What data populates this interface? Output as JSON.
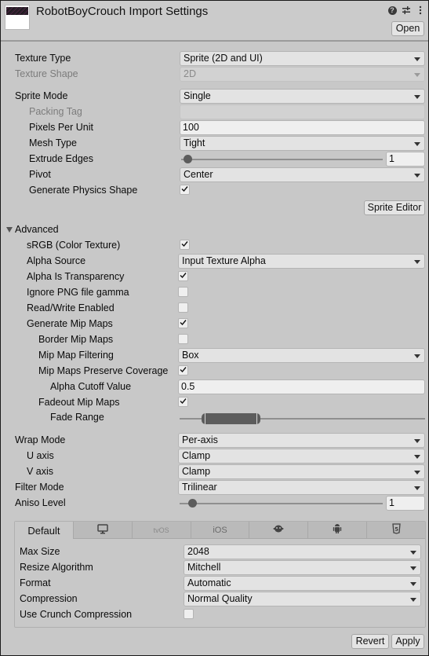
{
  "header": {
    "title": "RobotBoyCrouch Import Settings",
    "open_label": "Open",
    "icons": [
      "help-icon",
      "preset-sliders-icon",
      "more-menu-icon"
    ]
  },
  "texture": {
    "texture_type": {
      "label": "Texture Type",
      "value": "Sprite (2D and UI)"
    },
    "texture_shape": {
      "label": "Texture Shape",
      "value": "2D"
    },
    "sprite_mode": {
      "label": "Sprite Mode",
      "value": "Single"
    },
    "packing_tag": {
      "label": "Packing Tag",
      "value": ""
    },
    "pixels_per_unit": {
      "label": "Pixels Per Unit",
      "value": "100"
    },
    "mesh_type": {
      "label": "Mesh Type",
      "value": "Tight"
    },
    "extrude_edges": {
      "label": "Extrude Edges",
      "value": "1",
      "slider_fraction": 0.03
    },
    "pivot": {
      "label": "Pivot",
      "value": "Center"
    },
    "generate_physics_shape": {
      "label": "Generate Physics Shape",
      "checked": true
    },
    "sprite_editor_label": "Sprite Editor"
  },
  "advanced": {
    "label": "Advanced",
    "expanded": true,
    "srgb": {
      "label": "sRGB (Color Texture)",
      "checked": true
    },
    "alpha_source": {
      "label": "Alpha Source",
      "value": "Input Texture Alpha"
    },
    "alpha_is_transparency": {
      "label": "Alpha Is Transparency",
      "checked": true
    },
    "ignore_png_gamma": {
      "label": "Ignore PNG file gamma",
      "checked": false
    },
    "read_write": {
      "label": "Read/Write Enabled",
      "checked": false
    },
    "generate_mip_maps": {
      "label": "Generate Mip Maps",
      "checked": true
    },
    "border_mip_maps": {
      "label": "Border Mip Maps",
      "checked": false
    },
    "mip_map_filtering": {
      "label": "Mip Map Filtering",
      "value": "Box"
    },
    "mip_preserve_coverage": {
      "label": "Mip Maps Preserve Coverage",
      "checked": true
    },
    "alpha_cutoff": {
      "label": "Alpha Cutoff Value",
      "value": "0.5"
    },
    "fadeout_mip_maps": {
      "label": "Fadeout Mip Maps",
      "checked": true
    },
    "fade_range": {
      "label": "Fade Range",
      "min_fraction": 0.09,
      "max_fraction": 0.33
    }
  },
  "sampling": {
    "wrap_mode": {
      "label": "Wrap Mode",
      "value": "Per-axis"
    },
    "u_axis": {
      "label": "U axis",
      "value": "Clamp"
    },
    "v_axis": {
      "label": "V axis",
      "value": "Clamp"
    },
    "filter_mode": {
      "label": "Filter Mode",
      "value": "Trilinear"
    },
    "aniso_level": {
      "label": "Aniso Level",
      "value": "1",
      "slider_fraction": 0.06
    }
  },
  "platform": {
    "tabs": [
      {
        "label": "Default",
        "icon": null,
        "active": true
      },
      {
        "label": "",
        "icon": "monitor-icon",
        "active": false
      },
      {
        "label": "tvOS",
        "icon": null,
        "active": false
      },
      {
        "label": "iOS",
        "icon": null,
        "active": false
      },
      {
        "label": "",
        "icon": "webgl-mascot-icon",
        "active": false
      },
      {
        "label": "",
        "icon": "android-icon",
        "active": false
      },
      {
        "label": "",
        "icon": "html5-icon",
        "active": false
      }
    ],
    "max_size": {
      "label": "Max Size",
      "value": "2048"
    },
    "resize_algorithm": {
      "label": "Resize Algorithm",
      "value": "Mitchell"
    },
    "format": {
      "label": "Format",
      "value": "Automatic"
    },
    "compression": {
      "label": "Compression",
      "value": "Normal Quality"
    },
    "use_crunch": {
      "label": "Use Crunch Compression",
      "checked": false
    }
  },
  "footer": {
    "revert_label": "Revert",
    "apply_label": "Apply"
  }
}
